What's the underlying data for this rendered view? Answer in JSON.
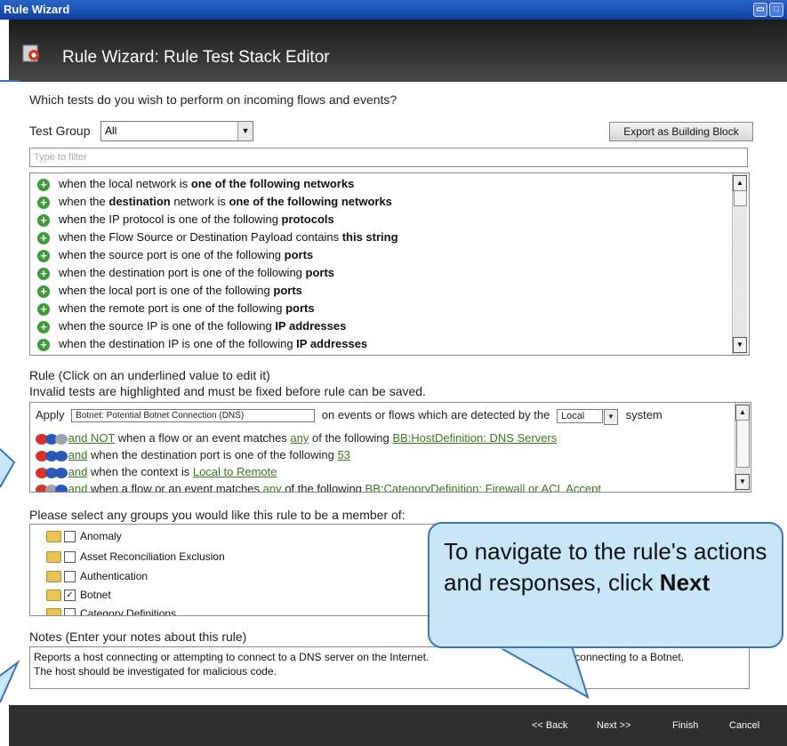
{
  "window": {
    "title": "Rule Wizard"
  },
  "header": {
    "title": "Rule Wizard: Rule Test Stack Editor"
  },
  "question": "Which tests do you wish to perform on incoming flows and events?",
  "test_group": {
    "label": "Test Group",
    "value": "All"
  },
  "export_button": "Export as Building Block",
  "filter": {
    "placeholder": "Type to filter"
  },
  "tests": [
    {
      "pre": "when the local network is ",
      "bold": "one of the following networks"
    },
    {
      "pre": "when the ",
      "bold": "destination",
      "mid": " network is ",
      "bold2": "one of the following networks"
    },
    {
      "pre": "when the IP protocol is one of the following ",
      "bold": "protocols"
    },
    {
      "pre": "when the Flow Source or Destination Payload contains ",
      "bold": "this string"
    },
    {
      "pre": "when the source port is one of the following ",
      "bold": "ports"
    },
    {
      "pre": "when the destination port is one of the following ",
      "bold": "ports"
    },
    {
      "pre": "when the local port is one of the following ",
      "bold": "ports"
    },
    {
      "pre": "when the remote port is one of the following ",
      "bold": "ports"
    },
    {
      "pre": "when the source IP is one of the following ",
      "bold": "IP addresses"
    },
    {
      "pre": "when the destination IP is one of the following ",
      "bold": "IP addresses"
    }
  ],
  "rule": {
    "label1": "Rule (Click on an underlined value to edit it)",
    "label2": "Invalid tests are highlighted and must be fixed before rule can be saved.",
    "apply": "Apply",
    "name": "Botnet: Potential Botnet Connection (DNS)",
    "detected_text": "on events or flows which are detected by the",
    "system_value": "Local",
    "system_text": "system",
    "lines": [
      {
        "link1": " and NOT",
        "text1": " when a flow or an event matches ",
        "link2": "any",
        "text2": " of the following ",
        "link3": "BB:HostDefinition: DNS Servers"
      },
      {
        "link1": " and",
        "text1": " when the destination port is one of the following ",
        "link2": "53",
        "text2": "",
        "link3": ""
      },
      {
        "link1": " and",
        "text1": " when the context is ",
        "link2": "Local to Remote",
        "text2": "",
        "link3": ""
      },
      {
        "link1": " and",
        "text1": " when a flow or an event matches ",
        "link2": "any",
        "text2": " of the following ",
        "link3": "BB:CategoryDefinition: Firewall or ACL Accept"
      }
    ]
  },
  "groups": {
    "label": "Please select any groups you would like this rule to be a member of:",
    "items": [
      {
        "name": "Anomaly",
        "checked": false
      },
      {
        "name": "Asset Reconciliation Exclusion",
        "checked": false
      },
      {
        "name": "Authentication",
        "checked": false
      },
      {
        "name": "Botnet",
        "checked": true
      },
      {
        "name": "Category Definitions",
        "checked": false
      }
    ]
  },
  "notes": {
    "label": "Notes (Enter your notes about this rule)",
    "line1": "Reports a host connecting or attempting to connect to a DNS server on the Internet.",
    "line1b": "e a host connecting to a Botnet.",
    "line2": "The host should be investigated for malicious code."
  },
  "footer": {
    "back": "<< Back",
    "next": "Next >>",
    "finish": "Finish",
    "cancel": "Cancel"
  },
  "callout": {
    "text": "To navigate to the rule's actions and responses, click ",
    "bold": "Next"
  },
  "colors": {
    "title_bar": "#0d3f9e",
    "header": "#2a2a2a",
    "link": "#3a7a1e",
    "add_icon": "#3e9b37",
    "callout_bg": "#c7e6f8",
    "callout_border": "#3a75b0"
  }
}
